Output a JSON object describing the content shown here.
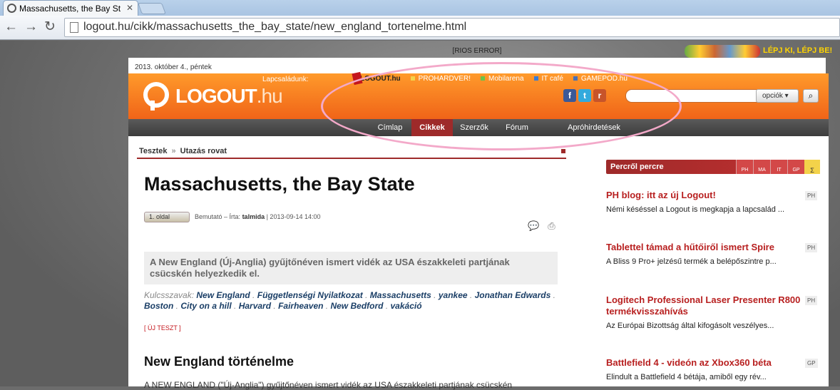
{
  "browser": {
    "tab_title": "Massachusetts, the Bay St",
    "tab_close": "✕",
    "url": "logout.hu/cikk/massachusetts_the_bay_state/new_england_tortenelme.html"
  },
  "ads": {
    "top_error": "[RIOS ERROR]",
    "right_text": "LÉPJ KI, LÉPJ BE!"
  },
  "header": {
    "date": "2013. október 4., péntek",
    "logo_main": "LOGOUT",
    "logo_suffix": ".hu",
    "family_label": "Lapcsaládunk:",
    "sites": [
      {
        "label": "LOGOUT.hu",
        "color": "#c4161c"
      },
      {
        "label": "PROHARDVER!",
        "color": "#f3d24a"
      },
      {
        "label": "Mobilarena",
        "color": "#6cc24a"
      },
      {
        "label": "IT café",
        "color": "#3a7bd5"
      },
      {
        "label": "GAMEPOD.hu",
        "color": "#4a6fb5"
      }
    ],
    "social": {
      "facebook": "f",
      "twitter": "t",
      "rss": "r"
    },
    "options_label": "opciók ▾"
  },
  "nav": {
    "items": [
      "Címlap",
      "Cikkek",
      "Szerzők",
      "Fórum",
      "Apróhirdetések"
    ],
    "active": "Cikkek"
  },
  "article": {
    "breadcrumb": [
      "Tesztek",
      "Utazás rovat"
    ],
    "breadcrumb_sep": "»",
    "title": "Massachusetts, the Bay State",
    "page_button": "1. oldal",
    "meta_prefix": "Bemutató – Írta:",
    "author": "talmida",
    "meta_date": "| 2013-09-14 14:00",
    "lead": "A New England (Új-Anglia) gyűjtőnéven ismert vidék az USA északkeleti partjának csücskén helyezkedik el.",
    "keywords_label": "Kulcsszavak:",
    "keywords": [
      "New England",
      "Függetlenségi Nyilatkozat",
      "Massachusetts",
      "yankee",
      "Jonathan Edwards",
      "Boston",
      "City on a hill",
      "Harvard",
      "Fairheaven",
      "New Bedford",
      "vakáció"
    ],
    "new_test": "[ ÚJ TESZT ]",
    "section_title": "New England történelme",
    "body_start": "A NEW ENGLAND (\"Új-Anglia\") gyűjtőnéven ismert vidék az USA északkeleti partjának csücskén"
  },
  "sidebar": {
    "header": "Percről percre",
    "columns": [
      "PH",
      "MA",
      "IT",
      "GP"
    ],
    "sigma": "Σ",
    "news": [
      {
        "title": "PH blog: itt az új Logout!",
        "summary": "Némi késéssel a Logout is megkapja a lapcsalád ...",
        "tag": "PH"
      },
      {
        "title": "Tablettel támad a hűtőiről ismert Spire",
        "summary": "A Bliss 9 Pro+ jelzésű termék a belépőszintre p...",
        "tag": "PH"
      },
      {
        "title": "Logitech Professional Laser Presenter R800 termékvisszahívás",
        "summary": "Az Európai Bizottság által kifogásolt veszélyes...",
        "tag": "PH"
      },
      {
        "title": "Battlefield 4 - videón az Xbox360 béta",
        "summary": "Elindult a Battlefield 4 bétája, amiből egy rév...",
        "tag": "GP"
      }
    ]
  }
}
